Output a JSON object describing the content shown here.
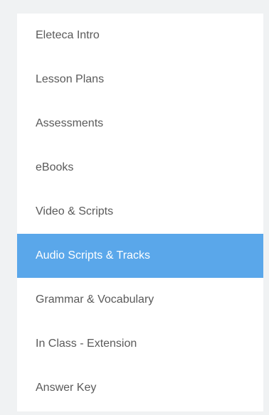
{
  "menu": {
    "items": [
      {
        "label": "Eleteca Intro",
        "active": false
      },
      {
        "label": "Lesson Plans",
        "active": false
      },
      {
        "label": "Assessments",
        "active": false
      },
      {
        "label": "eBooks",
        "active": false
      },
      {
        "label": "Video & Scripts",
        "active": false
      },
      {
        "label": "Audio Scripts & Tracks",
        "active": true
      },
      {
        "label": "Grammar & Vocabulary",
        "active": false
      },
      {
        "label": "In Class - Extension",
        "active": false
      },
      {
        "label": "Answer Key",
        "active": false
      }
    ]
  },
  "colors": {
    "page_background": "#f0f2f3",
    "panel_background": "#ffffff",
    "active_background": "#5aa7ea",
    "active_text": "#ffffff",
    "item_text": "#5a5a5a"
  }
}
